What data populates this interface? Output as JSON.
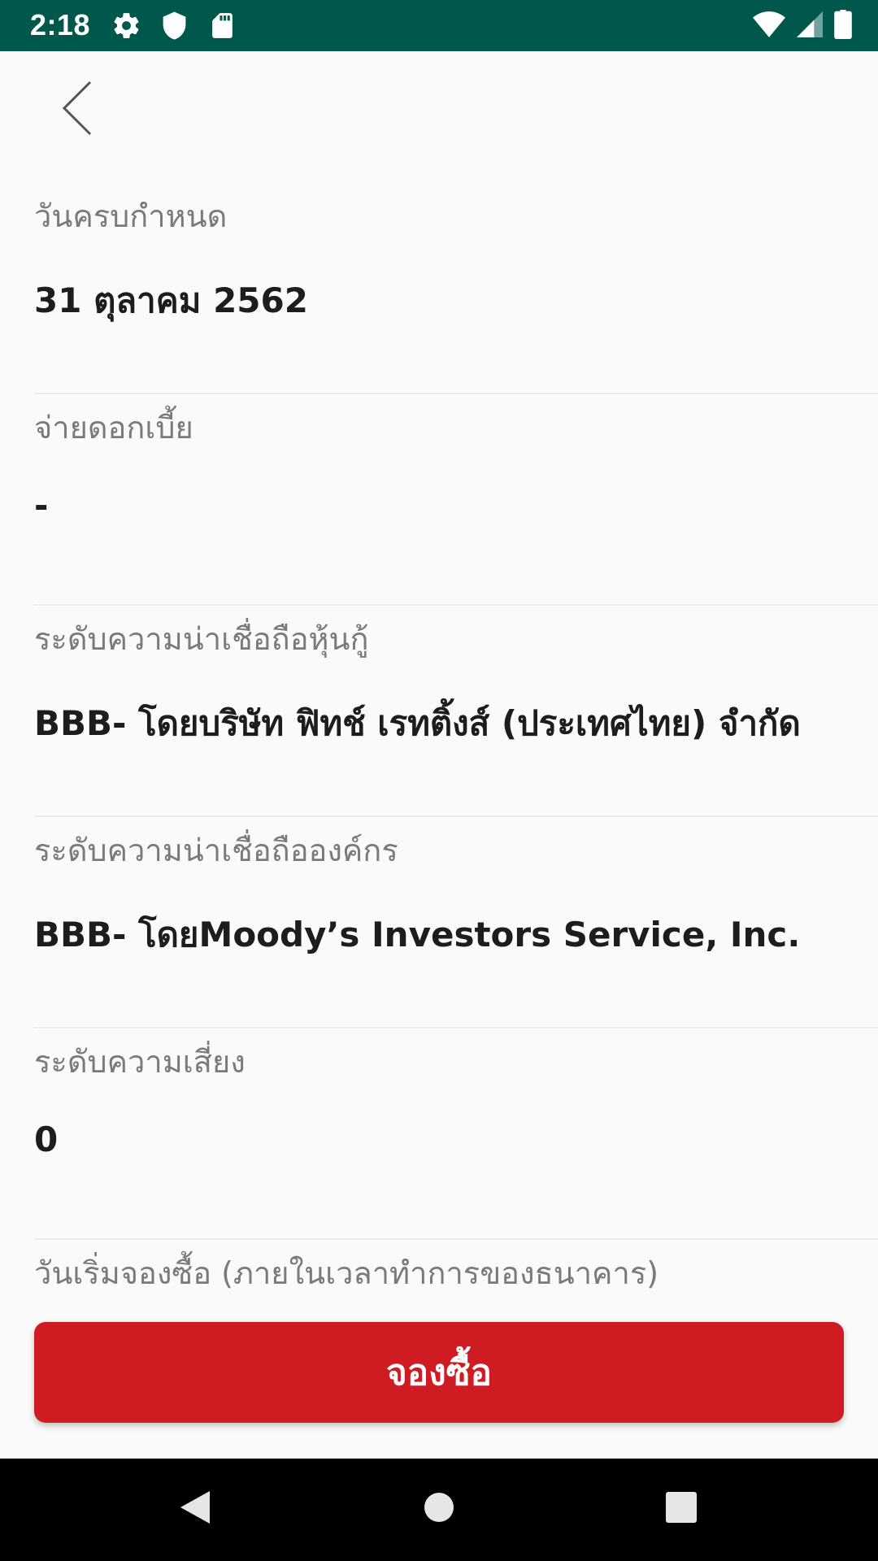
{
  "status_bar": {
    "time": "2:18",
    "left_icons": [
      "gear-icon",
      "shield-icon",
      "sd-card-icon"
    ],
    "right_icons": [
      "wifi-icon",
      "signal-icon",
      "battery-icon"
    ],
    "background_color": "#00574b"
  },
  "header": {
    "back_icon": "chevron-left-icon"
  },
  "fields": [
    {
      "label": "วันครบกำหนด",
      "value": "31 ตุลาคม 2562"
    },
    {
      "label": "จ่ายดอกเบี้ย",
      "value": "-"
    },
    {
      "label": "ระดับความน่าเชื่อถือหุ้นกู้",
      "value": "BBB- โดยบริษัท ฟิทช์ เรทติ้งส์ (ประเทศไทย) จำกัด"
    },
    {
      "label": "ระดับความน่าเชื่อถือองค์กร",
      "value": "BBB- โดยMoody’s Investors Service, Inc."
    },
    {
      "label": "ระดับความเสี่ยง",
      "value": "0"
    },
    {
      "label": "วันเริ่มจองซื้อ (ภายในเวลาทำการของธนาคาร)"
    }
  ],
  "primary_action": {
    "label": "จองซื้อ",
    "color": "#cf1b22"
  },
  "nav_bar": {
    "icons": [
      "nav-back-icon",
      "nav-home-icon",
      "nav-recents-icon"
    ]
  }
}
